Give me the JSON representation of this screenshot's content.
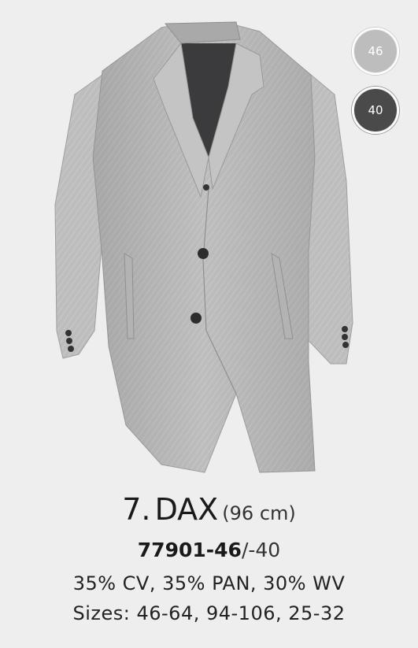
{
  "product": {
    "number": "7.",
    "name": "DAX",
    "length": "(96 cm)",
    "code_main": "77901-46",
    "code_alt": "/-40",
    "composition": "35% CV, 35% PAN, 30% WV",
    "sizes": "Sizes: 46-64, 94-106, 25-32"
  },
  "swatches": [
    {
      "label": "46",
      "color": "#bdbdbd"
    },
    {
      "label": "40",
      "color": "#4a4a4a"
    }
  ],
  "colors": {
    "background": "#eeeeee",
    "coat_fabric": "#b9b9b9",
    "lining": "#3b3b3d"
  }
}
